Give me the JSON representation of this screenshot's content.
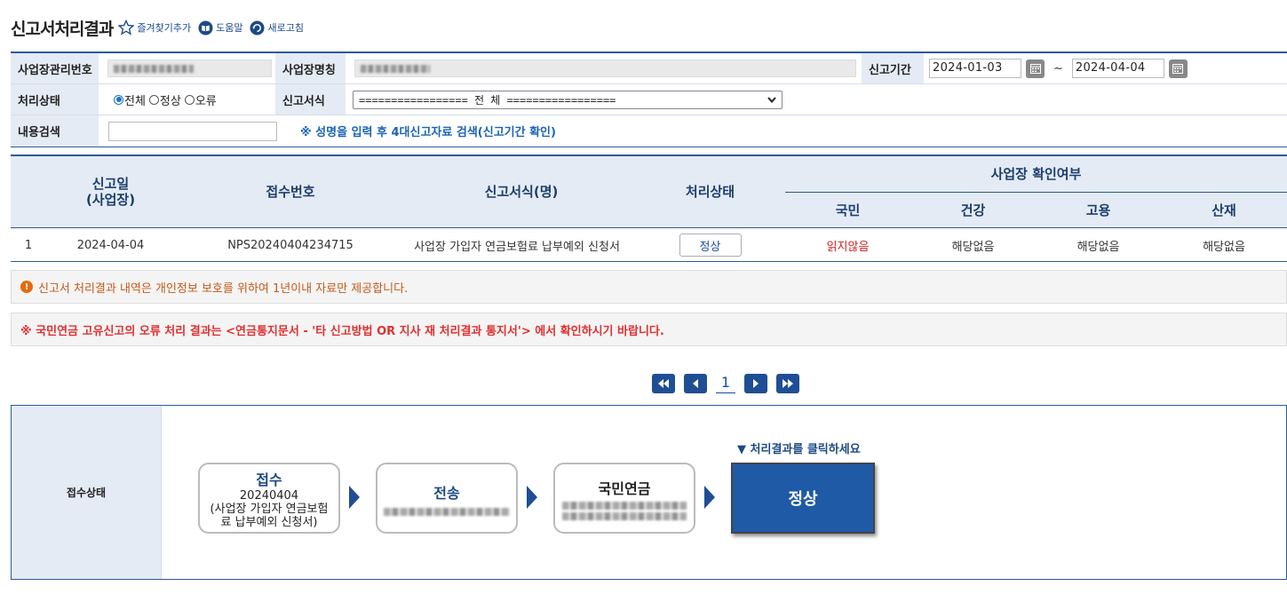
{
  "header": {
    "title": "신고서처리결과",
    "favorite": "즐겨찾기추가",
    "help": "도움말",
    "refresh": "새로고침"
  },
  "search": {
    "biz_mgmt_no_label": "사업장관리번호",
    "biz_name_label": "사업장명칭",
    "period_label": "신고기간",
    "date_from": "2024-01-03",
    "date_sep": "~",
    "date_to": "2024-04-04",
    "status_label": "처리상태",
    "status_options": [
      "전체",
      "정상",
      "오류"
    ],
    "status_selected": "전체",
    "form_label": "신고서식",
    "form_selected": "================= 전 체 =================",
    "content_label": "내용검색",
    "content_value": "",
    "hint": "※ 성명을 입력 후 4대신고자료 검색(신고기간 확인)"
  },
  "table": {
    "headers": {
      "date": "신고일\n(사업장)",
      "receipt_no": "접수번호",
      "form": "신고서식(명)",
      "status": "처리상태",
      "confirm_group": "사업장 확인여부",
      "national": "국민",
      "health": "건강",
      "employ": "고용",
      "industrial": "산재"
    },
    "rows": [
      {
        "no": "1",
        "date": "2024-04-04",
        "receipt_no": "NPS20240404234715",
        "form": "사업장 가입자 연금보험료 납부예외 신청서",
        "status": "정상",
        "national": "읽지않음",
        "health": "해당없음",
        "employ": "해당없음",
        "industrial": "해당없음"
      }
    ]
  },
  "notices": {
    "privacy": "신고서 처리결과 내역은 개인정보 보호를 위하여 1년이내 자료만 제공합니다.",
    "error": "※ 국민연금 고유신고의 오류 처리 결과는 <연금통지문서 - '타 신고방법 OR 지사 재 처리결과 통지서'> 에서 확인하시기 바랍니다."
  },
  "pager": {
    "current": "1"
  },
  "flow": {
    "label": "접수상태",
    "steps": [
      {
        "title": "접수",
        "detail1": "20240404",
        "detail2": "(사업장 가입자 연금보험",
        "detail3": "료 납부예외 신청서)"
      },
      {
        "title": "전송"
      },
      {
        "title": "국민연금"
      }
    ],
    "click_hint": "▼ 처리결과를 클릭하세요",
    "result": "정상"
  },
  "colors": {
    "primary": "#1f5aa6",
    "header_bg": "#e4ebf4",
    "accent_text": "#1c3e6e",
    "error": "#e03030"
  }
}
